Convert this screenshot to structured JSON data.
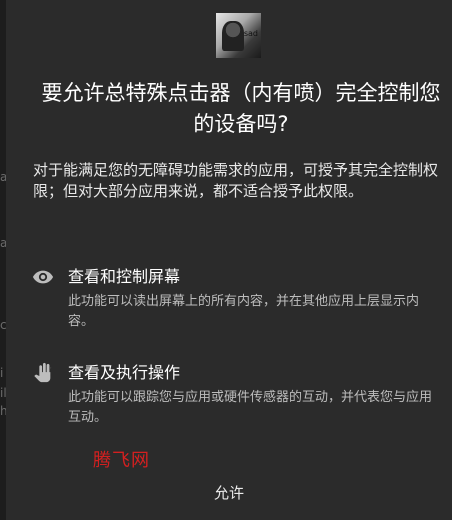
{
  "dialog": {
    "title": "要允许总特殊点击器（内有喷）完全控制您的设备吗?",
    "description": "对于能满足您的无障碍功能需求的应用，可授予其完全控制权限；但对大部分应用来说，都不适合授予此权限。",
    "app_icon_tag": "sad",
    "permissions": [
      {
        "icon": "eye-icon",
        "title": "查看和控制屏幕",
        "description": "此功能可以读出屏幕上的所有内容，并在其他应用上层显示内容。"
      },
      {
        "icon": "hand-icon",
        "title": "查看及执行操作",
        "description": "此功能可以跟踪您与应用或硬件传感器的互动，并代表您与应用互动。"
      }
    ],
    "allow_label": "允许",
    "watermark": "腾飞网"
  },
  "background": {
    "edge_glyphs": [
      "a",
      "a",
      "c",
      "i",
      "il",
      "h"
    ]
  },
  "colors": {
    "dialog_bg": "#2b2b2b",
    "text_primary": "#ffffff",
    "text_secondary": "#bdbdbd",
    "watermark": "#d42020"
  }
}
